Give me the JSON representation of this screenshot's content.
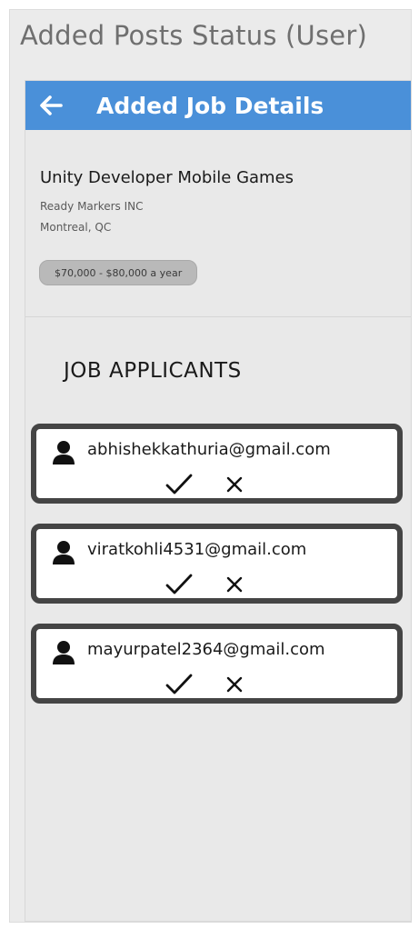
{
  "page_title": "Added Posts Status (User)",
  "appbar": {
    "title": "Added Job Details",
    "back_icon": "arrow-left-icon",
    "color": "#4a90d9"
  },
  "job": {
    "title": "Unity Developer Mobile Games",
    "company": "Ready Markers INC",
    "location": "Montreal, QC",
    "salary": "$70,000 - $80,000 a year"
  },
  "applicants_section": {
    "title": "JOB APPLICANTS",
    "items": [
      {
        "email": "abhishekkathuria@gmail.com",
        "icon": "person-icon"
      },
      {
        "email": "viratkohli4531@gmail.com",
        "icon": "person-icon"
      },
      {
        "email": "mayurpatel2364@gmail.com",
        "icon": "person-icon"
      }
    ]
  }
}
